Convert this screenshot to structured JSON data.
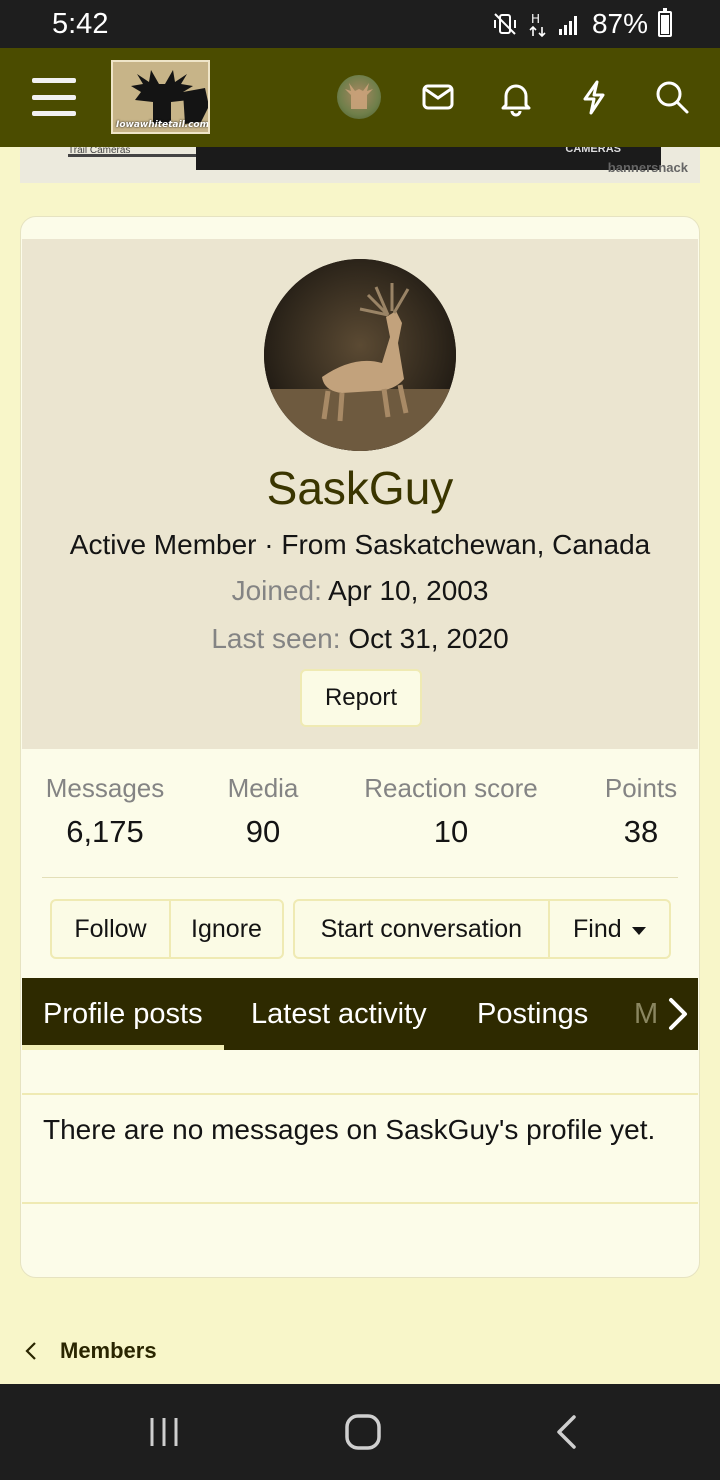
{
  "status_bar": {
    "time": "5:42",
    "battery": "87%",
    "battery_level": 0.87,
    "icons": [
      "vibrate-mute-icon",
      "hplus-data-icon",
      "signal-icon",
      "battery-icon"
    ]
  },
  "header": {
    "menu_icon": "hamburger-menu-icon",
    "logo_text": "Iowawhitetail.com",
    "icons": [
      "user-avatar",
      "inbox-icon",
      "bell-icon",
      "lightning-icon",
      "search-icon"
    ],
    "colors": {
      "bar": "#4b4c00"
    }
  },
  "banner": {
    "brand": "bannersnack",
    "fragment_left": "Trail Cameras",
    "fragment_right": "CAMERAS"
  },
  "profile": {
    "username": "SaskGuy",
    "subtitle": "Active Member · From Saskatchewan, Canada",
    "joined_label": "Joined:",
    "joined_value": "Apr 10, 2003",
    "last_seen_label": "Last seen:",
    "last_seen_value": "Oct 31, 2020",
    "report_label": "Report"
  },
  "stats": [
    {
      "label": "Messages",
      "value": "6,175"
    },
    {
      "label": "Media",
      "value": "90"
    },
    {
      "label": "Reaction score",
      "value": "10"
    },
    {
      "label": "Points",
      "value": "38"
    }
  ],
  "actions": {
    "follow": "Follow",
    "ignore": "Ignore",
    "start_conversation": "Start conversation",
    "find": "Find"
  },
  "tabs": [
    {
      "label": "Profile posts",
      "active": true
    },
    {
      "label": "Latest activity",
      "active": false
    },
    {
      "label": "Postings",
      "active": false
    },
    {
      "label": "M",
      "active": false
    }
  ],
  "empty_message": "There are no messages on SaskGuy's profile yet.",
  "breadcrumb": {
    "label": "Members"
  },
  "nav_bar": {
    "icons": [
      "recent-apps-icon",
      "home-icon",
      "back-icon"
    ]
  }
}
